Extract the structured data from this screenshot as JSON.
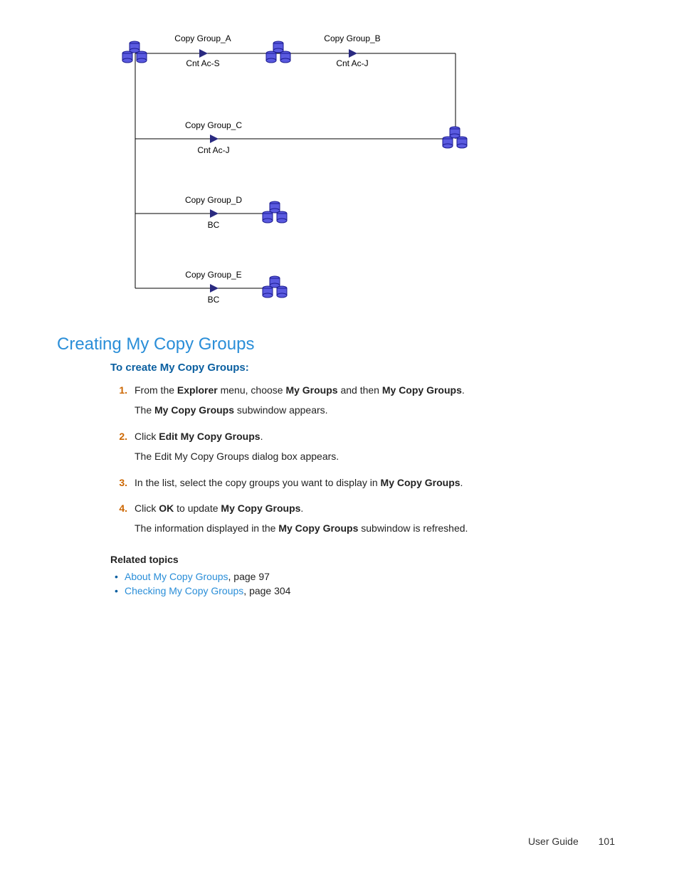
{
  "diagram": {
    "labels": {
      "cga": "Copy Group_A",
      "cgb": "Copy Group_B",
      "cgc": "Copy Group_C",
      "cgd": "Copy Group_D",
      "cge": "Copy Group_E",
      "cnt_ac_s": "Cnt Ac-S",
      "cnt_ac_j1": "Cnt Ac-J",
      "cnt_ac_j2": "Cnt Ac-J",
      "bc1": "BC",
      "bc2": "BC"
    }
  },
  "section": {
    "title": "Creating My Copy Groups",
    "subtitle": "To create My Copy Groups:"
  },
  "steps": [
    {
      "num": "1.",
      "lines": [
        {
          "runs": [
            {
              "t": "From the "
            },
            {
              "t": "Explorer",
              "b": true
            },
            {
              "t": " menu, choose "
            },
            {
              "t": "My Groups",
              "b": true
            },
            {
              "t": " and then "
            },
            {
              "t": "My Copy Groups",
              "b": true
            },
            {
              "t": "."
            }
          ]
        },
        {
          "runs": [
            {
              "t": "The "
            },
            {
              "t": "My Copy Groups",
              "b": true
            },
            {
              "t": " subwindow appears."
            }
          ]
        }
      ]
    },
    {
      "num": "2.",
      "lines": [
        {
          "runs": [
            {
              "t": "Click "
            },
            {
              "t": "Edit My Copy Groups",
              "b": true
            },
            {
              "t": "."
            }
          ]
        },
        {
          "runs": [
            {
              "t": "The Edit My Copy Groups dialog box appears."
            }
          ]
        }
      ]
    },
    {
      "num": "3.",
      "lines": [
        {
          "runs": [
            {
              "t": "In the list, select the copy groups you want to display in "
            },
            {
              "t": "My Copy Groups",
              "b": true
            },
            {
              "t": "."
            }
          ]
        }
      ]
    },
    {
      "num": "4.",
      "lines": [
        {
          "runs": [
            {
              "t": "Click "
            },
            {
              "t": "OK",
              "b": true
            },
            {
              "t": " to update "
            },
            {
              "t": "My Copy Groups",
              "b": true
            },
            {
              "t": "."
            }
          ]
        },
        {
          "runs": [
            {
              "t": "The information displayed in the "
            },
            {
              "t": "My Copy Groups",
              "b": true
            },
            {
              "t": " subwindow is refreshed."
            }
          ]
        }
      ]
    }
  ],
  "related": {
    "heading": "Related topics",
    "items": [
      {
        "link": "About My Copy Groups",
        "suffix": ", page 97"
      },
      {
        "link": "Checking My Copy Groups",
        "suffix": ", page 304"
      }
    ]
  },
  "footer": {
    "label": "User Guide",
    "page": "101"
  }
}
